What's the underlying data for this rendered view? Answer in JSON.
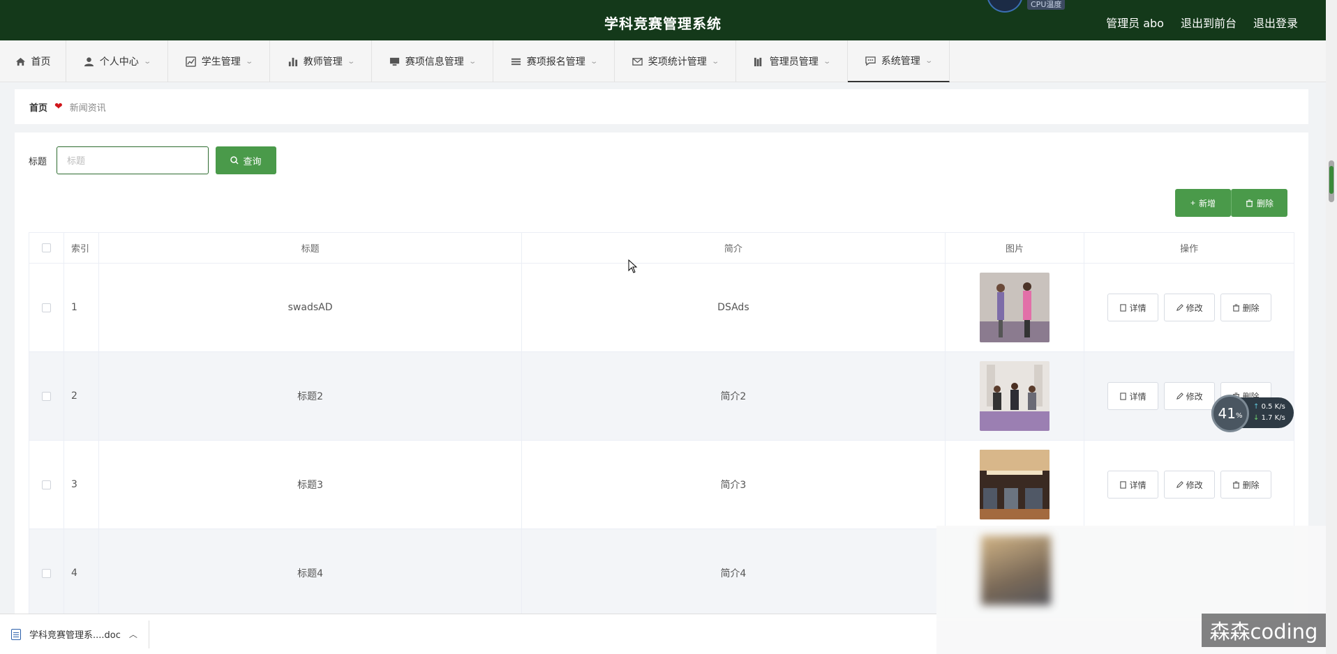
{
  "header": {
    "title": "学科竞赛管理系统",
    "user": "管理员 abo",
    "back_to_front": "退出到前台",
    "logout": "退出登录",
    "cpu_label": "CPU温度"
  },
  "nav": {
    "items": [
      {
        "label": "首页",
        "icon": "home-icon"
      },
      {
        "label": "个人中心",
        "icon": "user-icon"
      },
      {
        "label": "学生管理",
        "icon": "chart-icon"
      },
      {
        "label": "教师管理",
        "icon": "bar-chart-icon"
      },
      {
        "label": "赛项信息管理",
        "icon": "monitor-icon"
      },
      {
        "label": "赛项报名管理",
        "icon": "list-icon"
      },
      {
        "label": "奖项统计管理",
        "icon": "mail-icon"
      },
      {
        "label": "管理员管理",
        "icon": "books-icon"
      },
      {
        "label": "系统管理",
        "icon": "chat-icon"
      }
    ]
  },
  "breadcrumb": {
    "home": "首页",
    "current": "新闻资讯"
  },
  "search": {
    "label": "标题",
    "placeholder": "标题",
    "button": "查询"
  },
  "actions": {
    "add": "新增",
    "delete": "删除"
  },
  "table": {
    "columns": [
      "索引",
      "标题",
      "简介",
      "图片",
      "操作"
    ],
    "rows": [
      {
        "index": "1",
        "title": "swadsAD",
        "desc": "DSAds"
      },
      {
        "index": "2",
        "title": "标题2",
        "desc": "简介2"
      },
      {
        "index": "3",
        "title": "标题3",
        "desc": "简介3"
      },
      {
        "index": "4",
        "title": "标题4",
        "desc": "简介4"
      }
    ],
    "op_detail": "详情",
    "op_edit": "修改",
    "op_delete": "删除"
  },
  "download": {
    "filename": "学科竞赛管理系....doc"
  },
  "speed": {
    "percent": "41",
    "unit": "%",
    "up": "0.5",
    "down": "1.7",
    "rate_unit": "K/s"
  },
  "watermark": "森森coding",
  "colors": {
    "header_bg": "#14391a",
    "primary_button": "#4a9a4a"
  }
}
